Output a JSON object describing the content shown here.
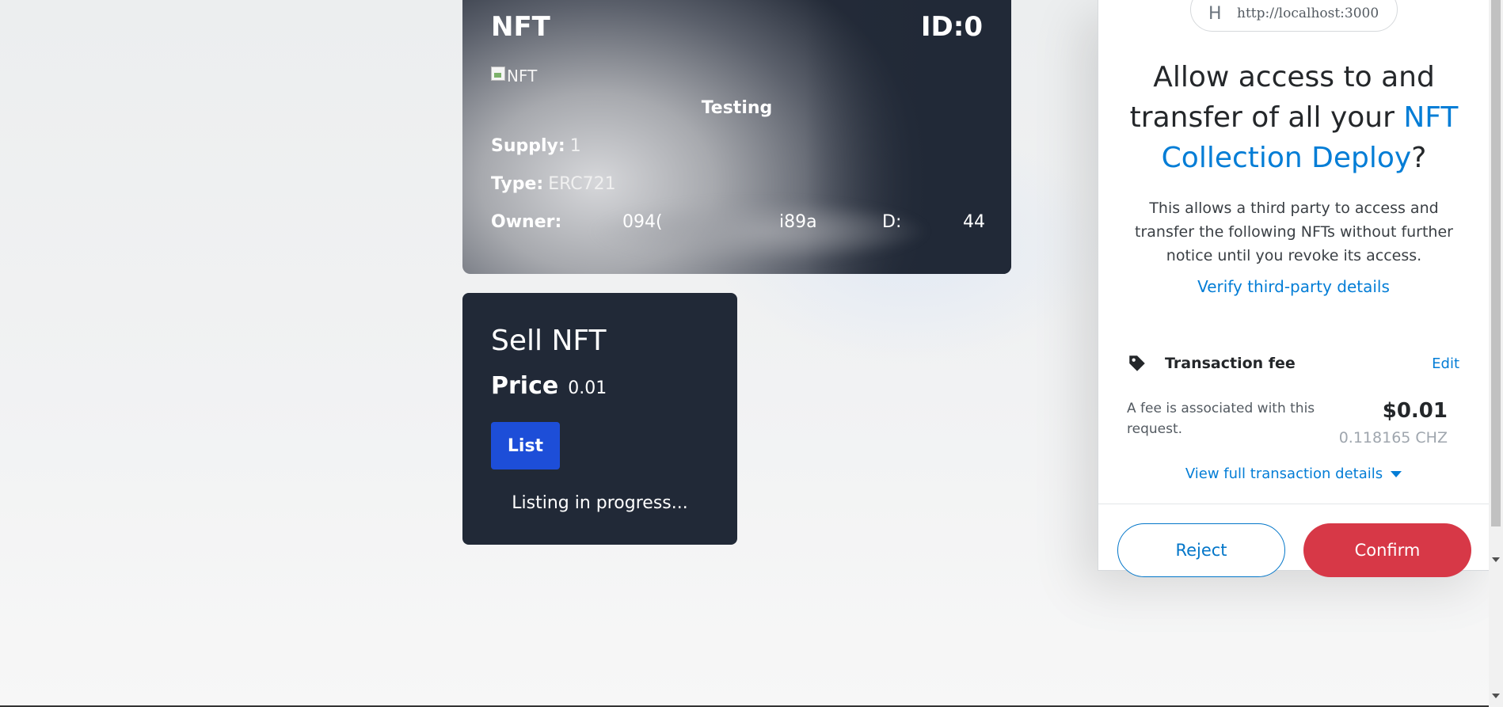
{
  "nft_card": {
    "title": "NFT",
    "id_label": "ID:0",
    "image_alt": "NFT",
    "name": "Testing",
    "supply_label": "Supply:",
    "supply_value": "1",
    "type_label": "Type:",
    "type_value": "ERC721",
    "owner_label": "Owner:",
    "owner_fragments": [
      "094(",
      "i89a",
      "D:",
      "44"
    ]
  },
  "sell_card": {
    "title": "Sell NFT",
    "price_label": "Price",
    "price_value": "0.01",
    "list_button": "List",
    "status": "Listing in progress..."
  },
  "wallet": {
    "origin_avatar": "H",
    "origin_url": "http://localhost:3000",
    "title_part1": "Allow access to and transfer of all your ",
    "title_link": "NFT Collection Deploy",
    "title_end": "?",
    "description": "This allows a third party to access and transfer the following NFTs without further notice until you revoke its access.",
    "verify_link": "Verify third-party details",
    "fee_label": "Transaction fee",
    "fee_edit": "Edit",
    "fee_note": "A fee is associated with this request.",
    "fee_usd": "$0.01",
    "fee_native": "0.118165 CHZ",
    "view_full": "View full transaction details",
    "reject": "Reject",
    "confirm": "Confirm"
  },
  "colors": {
    "card_dark": "#212937",
    "list_button": "#1d4ed8",
    "link_blue": "#037dd6",
    "confirm_red": "#d73847"
  },
  "icons": [
    "broken-image-icon",
    "tag-icon",
    "chevron-down-icon",
    "scroll-down-arrow-icon"
  ]
}
